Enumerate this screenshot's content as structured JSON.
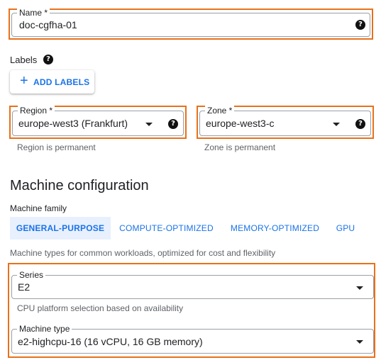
{
  "name_field": {
    "label": "Name *",
    "value": "doc-cgfha-01"
  },
  "labels": {
    "title": "Labels",
    "add_button": "ADD LABELS"
  },
  "region_field": {
    "label": "Region *",
    "value": "europe-west3 (Frankfurt)",
    "hint": "Region is permanent"
  },
  "zone_field": {
    "label": "Zone *",
    "value": "europe-west3-c",
    "hint": "Zone is permanent"
  },
  "machine_config": {
    "heading": "Machine configuration",
    "family_label": "Machine family",
    "tabs": [
      {
        "label": "GENERAL-PURPOSE",
        "active": true
      },
      {
        "label": "COMPUTE-OPTIMIZED",
        "active": false
      },
      {
        "label": "MEMORY-OPTIMIZED",
        "active": false
      },
      {
        "label": "GPU",
        "active": false
      }
    ],
    "family_description": "Machine types for common workloads, optimized for cost and flexibility"
  },
  "series_field": {
    "label": "Series",
    "value": "E2",
    "hint": "CPU platform selection based on availability"
  },
  "machine_type_field": {
    "label": "Machine type",
    "value": "e2-highcpu-16 (16 vCPU, 16 GB memory)"
  },
  "colors": {
    "highlight": "#e8711a",
    "accent": "#1a73e8",
    "active_tab_bg": "#e8f0fe"
  },
  "icons": {
    "help": "help-circle-icon",
    "dropdown": "caret-down-icon",
    "add": "plus-icon"
  }
}
